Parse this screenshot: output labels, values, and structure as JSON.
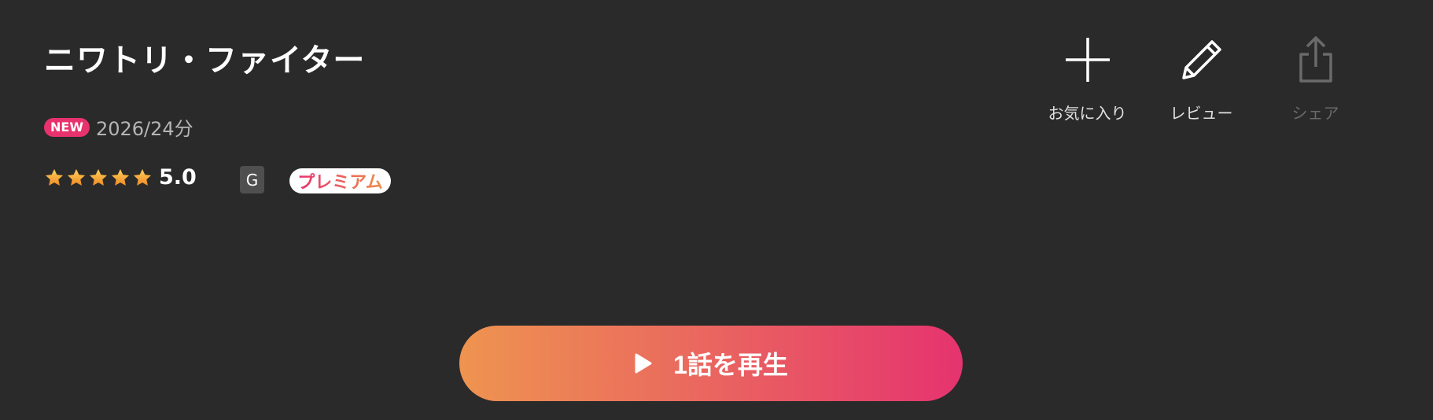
{
  "title": "ニワトリ・ファイター",
  "meta": {
    "new_badge": "NEW",
    "year_duration": "2026/24分"
  },
  "rating": {
    "value": "5.0",
    "stars": 5,
    "max_stars": 5
  },
  "age_rating": "G",
  "premium_label": "プレミアム",
  "actions": {
    "favorite_label": "お気に入り",
    "review_label": "レビュー",
    "share_label": "シェア"
  },
  "play_button": {
    "label": "1話を再生"
  },
  "colors": {
    "background": "#2a2a2a",
    "accent_pink": "#e8326e",
    "accent_orange": "#ee9450",
    "star": "#f5a623"
  },
  "icons": {
    "favorite": "plus-icon",
    "review": "pencil-icon",
    "share": "share-icon",
    "play": "play-icon",
    "star": "star-icon"
  }
}
